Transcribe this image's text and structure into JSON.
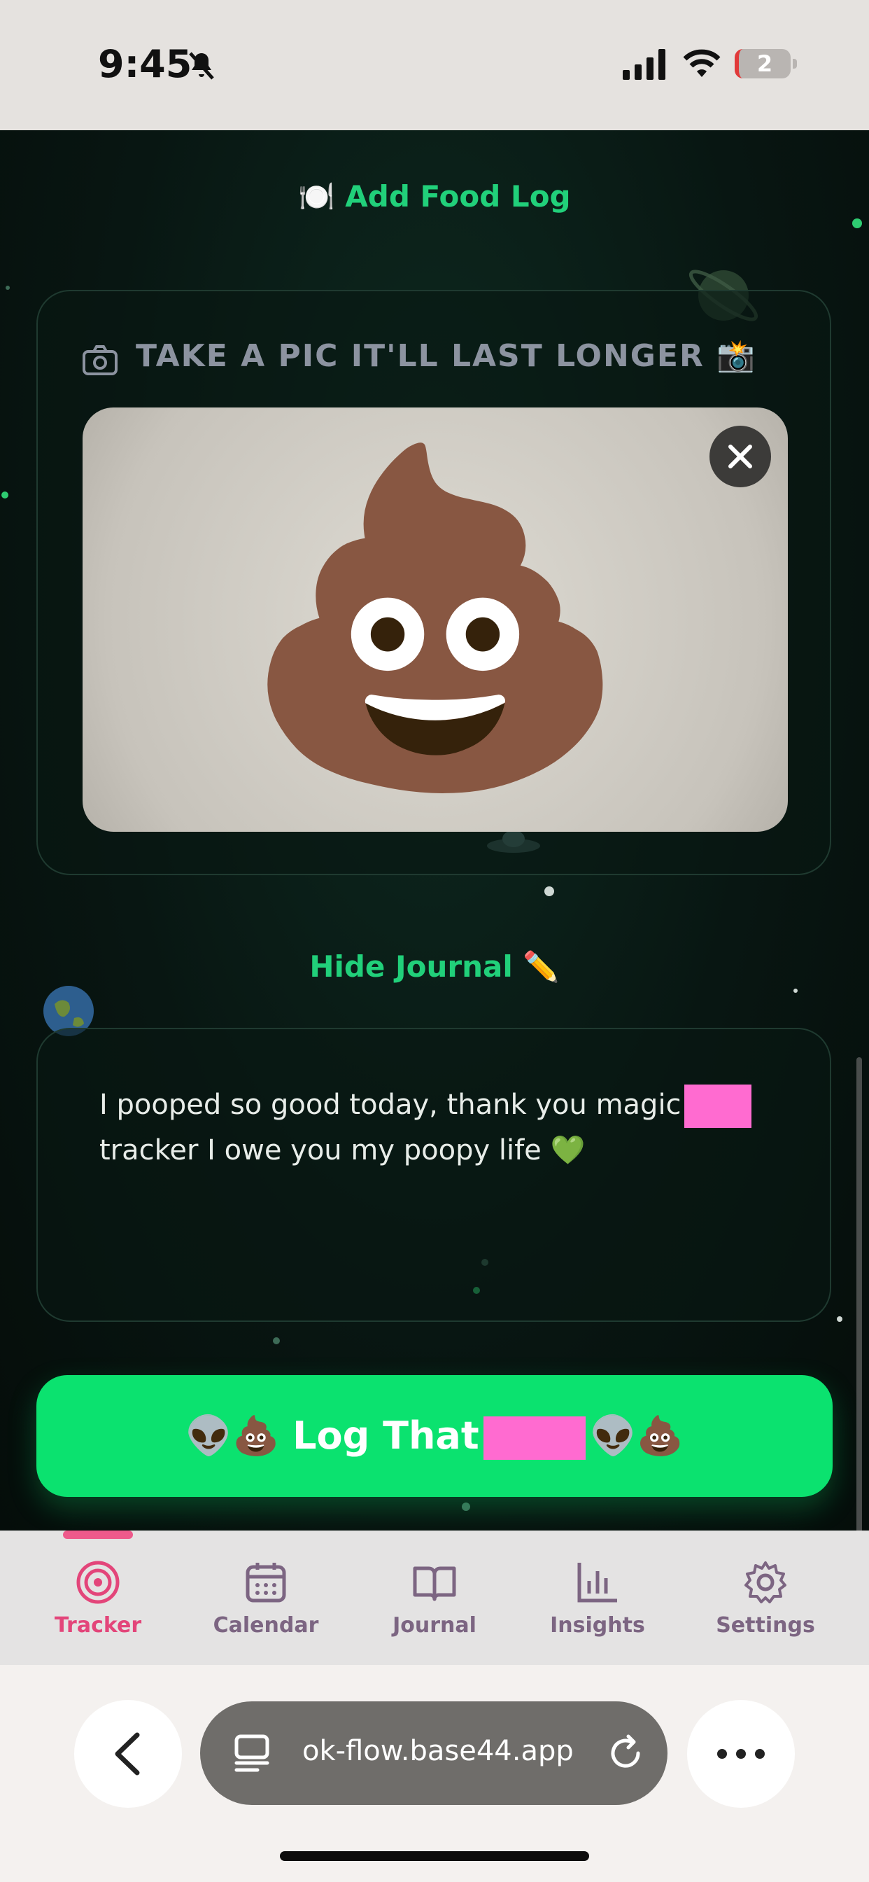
{
  "status_bar": {
    "time": "9:45",
    "battery": "2"
  },
  "food_log": {
    "label": "🍽️ Add Food Log"
  },
  "photo_section": {
    "header": "TAKE A PIC IT'LL LAST LONGER 📸",
    "photo_emoji": "💩"
  },
  "journal": {
    "toggle_label": "Hide Journal ✏️",
    "text_part1": "I pooped so good today, thank you magic",
    "text_part2": "tracker I owe you my poopy life 💚"
  },
  "log_button": {
    "prefix": "👽💩 Log That",
    "suffix": "👽💩"
  },
  "tabs": [
    {
      "label": "Tracker",
      "icon": "target-icon",
      "active": true
    },
    {
      "label": "Calendar",
      "icon": "calendar-icon"
    },
    {
      "label": "Journal",
      "icon": "book-icon"
    },
    {
      "label": "Insights",
      "icon": "bar-chart-icon"
    },
    {
      "label": "Settings",
      "icon": "gear-icon"
    }
  ],
  "browser": {
    "url": "ok-flow.base44.app"
  },
  "colors": {
    "accent_green": "#0be26f",
    "accent_pink": "#e3457a",
    "redaction": "#ff6bd0"
  }
}
